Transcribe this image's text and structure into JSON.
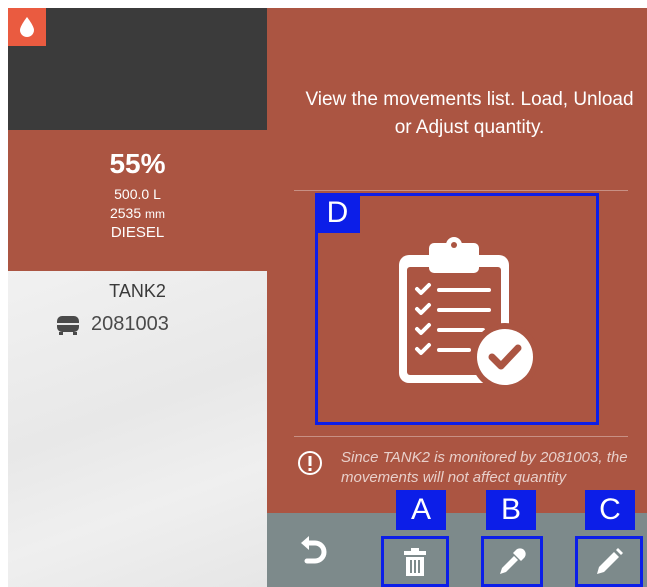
{
  "tank": {
    "level_percent": "55%",
    "volume": "500.0 L",
    "height_value": "2535",
    "height_unit": "mm",
    "fuel": "DIESEL",
    "name": "TANK2",
    "device_id": "2081003",
    "drop_icon": "water-drop-icon",
    "device_icon": "gauge-device-icon"
  },
  "panel": {
    "description": "View the movements list. Load, Unload or Adjust quantity.",
    "movements_icon": "clipboard-check-icon",
    "warning_icon": "exclamation-circle-icon",
    "warning_text": "Since TANK2 is monitored by 2081003, the movements will not affect quantity"
  },
  "toolbar": {
    "undo_icon": "undo-icon",
    "delete_icon": "trash-icon",
    "sample_icon": "pipette-icon",
    "edit_icon": "pencil-icon"
  },
  "annotations": {
    "a": "A",
    "b": "B",
    "c": "C",
    "d": "D"
  },
  "colors": {
    "accent": "#ab5542",
    "drop_button": "#ea5b40",
    "dark": "#3b3b3b",
    "toolbar": "#7d8a8b",
    "highlight": "#0c1ee8"
  }
}
